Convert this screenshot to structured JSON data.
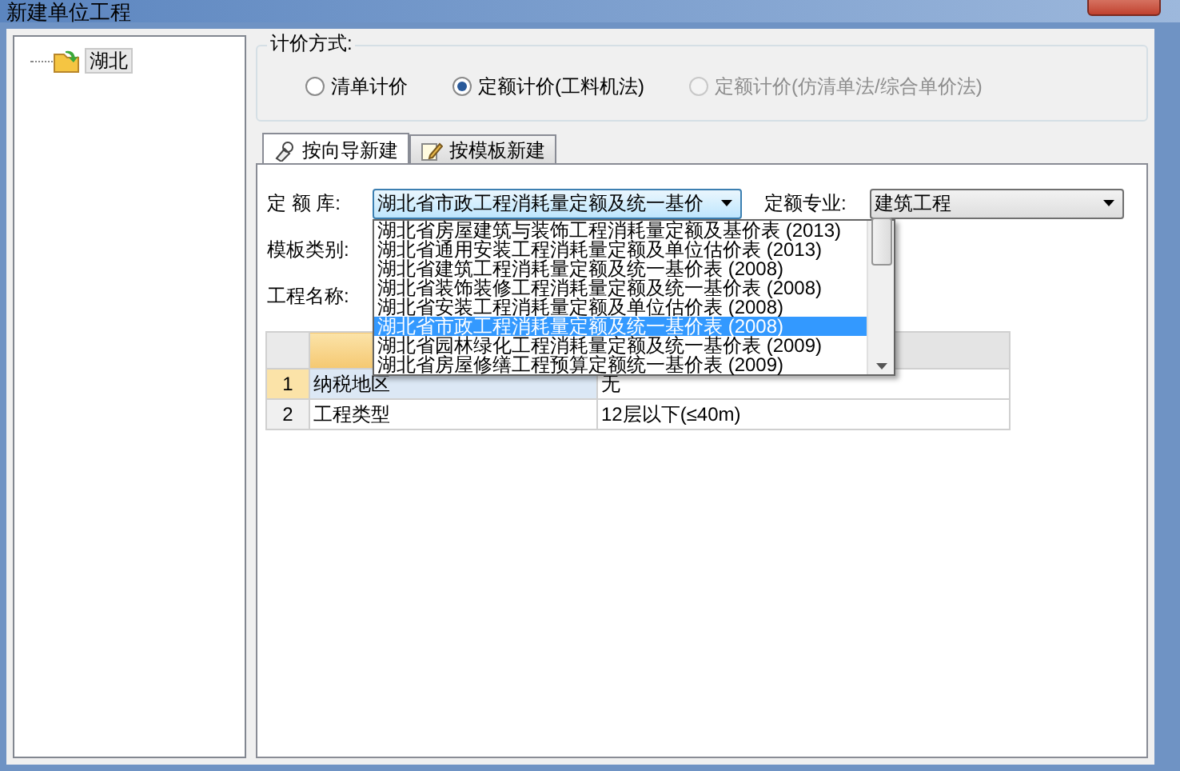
{
  "window": {
    "title": "新建单位工程"
  },
  "tree": [
    {
      "label": "湖北",
      "selected": true
    }
  ],
  "pricing_method": {
    "label": "计价方式:",
    "options": [
      {
        "label": "清单计价",
        "selected": false,
        "disabled": false
      },
      {
        "label": "定额计价(工料机法)",
        "selected": true,
        "disabled": false
      },
      {
        "label": "定额计价(仿清单法/综合单价法)",
        "selected": false,
        "disabled": true
      }
    ]
  },
  "tabs": [
    {
      "label": "按向导新建",
      "selected": true
    },
    {
      "label": "按模板新建",
      "selected": false
    }
  ],
  "quota_library": {
    "label": "定 额 库:",
    "value": "湖北省市政工程消耗量定额及统一基价",
    "expanded": true,
    "options": [
      {
        "label": "湖北省房屋建筑与装饰工程消耗量定额及基价表 (2013)",
        "selected": false
      },
      {
        "label": "湖北省通用安装工程消耗量定额及单位估价表 (2013)",
        "selected": false
      },
      {
        "label": "湖北省建筑工程消耗量定额及统一基价表 (2008)",
        "selected": false
      },
      {
        "label": "湖北省装饰装修工程消耗量定额及统一基价表 (2008)",
        "selected": false
      },
      {
        "label": "湖北省安装工程消耗量定额及单位估价表 (2008)",
        "selected": false
      },
      {
        "label": "湖北省市政工程消耗量定额及统一基价表 (2008)",
        "selected": true
      },
      {
        "label": "湖北省园林绿化工程消耗量定额及统一基价表 (2009)",
        "selected": false
      },
      {
        "label": "湖北省房屋修缮工程预算定额统一基价表 (2009)",
        "selected": false
      }
    ]
  },
  "specialty": {
    "label": "定额专业:",
    "value": "建筑工程"
  },
  "template_category": {
    "label": "模板类别:"
  },
  "project_name": {
    "label": "工程名称:"
  },
  "table": {
    "rows": [
      {
        "index": "1",
        "name": "纳税地区",
        "value": "无",
        "selected": true
      },
      {
        "index": "2",
        "name": "工程类型",
        "value": "12层以下(≤40m)",
        "selected": false
      }
    ]
  }
}
